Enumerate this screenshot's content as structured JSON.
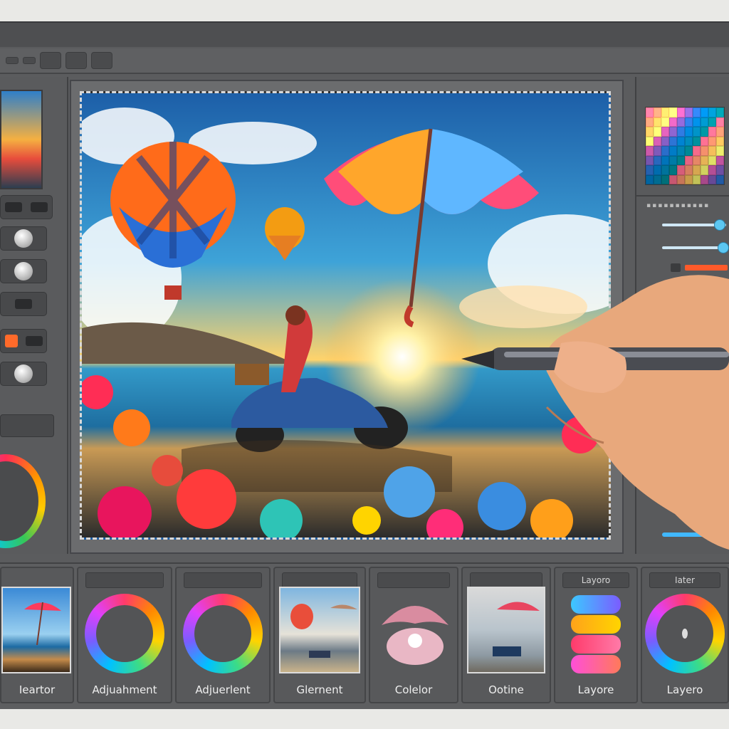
{
  "menubar": {
    "items": [
      "",
      "",
      "",
      "",
      "",
      "",
      "",
      ""
    ]
  },
  "toolbar": {
    "options": [
      "",
      ""
    ],
    "buttons": [
      "",
      "",
      ""
    ]
  },
  "left_panel": {
    "layer_label": ""
  },
  "right_panel": {
    "title": "",
    "swatch_colors": [
      "#ff6f91",
      "#ff9671",
      "#ffc75f",
      "#f9f871",
      "#d65db1",
      "#845ec2",
      "#2c73d2",
      "#0081cf",
      "#0089ba",
      "#008e9b"
    ],
    "slider_values": [
      0.9,
      0.95
    ],
    "accent": "#41b8ff"
  },
  "bottom_panel": {
    "cells": [
      {
        "tab": "",
        "label": "Ieartor"
      },
      {
        "tab": "",
        "label": "Adjuahment"
      },
      {
        "tab": "",
        "label": "Adjuerlent"
      },
      {
        "tab": "",
        "label": "Glernent"
      },
      {
        "tab": "",
        "label": "Colelor"
      },
      {
        "tab": "",
        "label": "Ootine"
      },
      {
        "tab": "Layoro",
        "label": "Layore"
      },
      {
        "tab": "Iater",
        "label": "Layero"
      }
    ]
  }
}
